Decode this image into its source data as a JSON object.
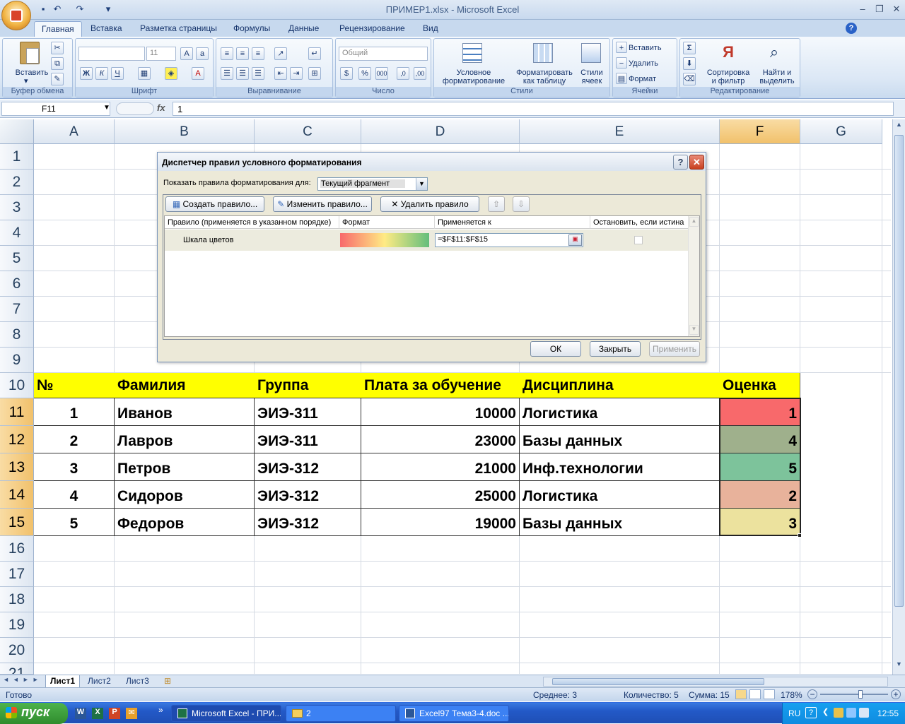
{
  "window": {
    "title": "ПРИМЕР1.xlsx - Microsoft Excel"
  },
  "ribbon": {
    "tabs": [
      "Главная",
      "Вставка",
      "Разметка страницы",
      "Формулы",
      "Данные",
      "Рецензирование",
      "Вид"
    ],
    "active_tab": "Главная",
    "groups": {
      "clipboard": {
        "label": "Буфер обмена",
        "paste": "Вставить"
      },
      "font": {
        "label": "Шрифт",
        "font_size": "11"
      },
      "alignment": {
        "label": "Выравнивание"
      },
      "number": {
        "label": "Число",
        "format": "Общий"
      },
      "styles": {
        "label": "Стили",
        "conditional": [
          "Условное",
          "форматирование"
        ],
        "table": [
          "Форматировать",
          "как таблицу"
        ],
        "cell_styles": [
          "Стили",
          "ячеек"
        ]
      },
      "cells": {
        "label": "Ячейки",
        "insert": "Вставить",
        "delete": "Удалить",
        "format": "Формат"
      },
      "editing": {
        "label": "Редактирование",
        "sort": [
          "Сортировка",
          "и фильтр"
        ],
        "find": [
          "Найти и",
          "выделить"
        ]
      }
    }
  },
  "formula_bar": {
    "name_box": "F11",
    "fx": "fx",
    "value": "1"
  },
  "grid": {
    "columns": [
      "A",
      "B",
      "C",
      "D",
      "E",
      "F",
      "G"
    ],
    "selected_column": "F",
    "rows": [
      "1",
      "2",
      "3",
      "4",
      "5",
      "6",
      "7",
      "8",
      "9",
      "10",
      "11",
      "12",
      "13",
      "14",
      "15",
      "16",
      "17",
      "18",
      "19",
      "20",
      "21"
    ],
    "selected_rows": [
      "11",
      "12",
      "13",
      "14",
      "15"
    ],
    "header_row": [
      "№",
      "Фамилия",
      "Группа",
      "Плата за обучение",
      "Дисциплина",
      "Оценка"
    ],
    "data_rows": [
      [
        "1",
        "Иванов",
        "ЭИЭ-311",
        "10000",
        "Логистика",
        "1"
      ],
      [
        "2",
        "Лавров",
        "ЭИЭ-311",
        "23000",
        "Базы данных",
        "4"
      ],
      [
        "3",
        "Петров",
        "ЭИЭ-312",
        "21000",
        "Инф.технологии",
        "5"
      ],
      [
        "4",
        "Сидоров",
        "ЭИЭ-312",
        "25000",
        "Логистика",
        "2"
      ],
      [
        "5",
        "Федоров",
        "ЭИЭ-312",
        "19000",
        "Базы данных",
        "3"
      ]
    ],
    "score_colors": [
      "#f8696b",
      "#9fb08c",
      "#7dc39b",
      "#e8b29b",
      "#ece29e"
    ],
    "header_fill": "#ffff00"
  },
  "dialog": {
    "title": "Диспетчер правил условного форматирования",
    "show_rules_label": "Показать правила форматирования для:",
    "show_rules_value": "Текущий фрагмент",
    "buttons": {
      "new_rule": "Создать правило...",
      "edit_rule": "Изменить правило...",
      "delete_rule": "Удалить правило",
      "ok": "ОК",
      "close": "Закрыть",
      "apply": "Применить"
    },
    "columns": [
      "Правило (применяется в указанном порядке)",
      "Формат",
      "Применяется к",
      "Остановить, если истина"
    ],
    "rule": {
      "name": "Шкала цветов",
      "applies_to": "=$F$11:$F$15",
      "stop_if_true": false
    }
  },
  "sheets": {
    "tabs": [
      "Лист1",
      "Лист2",
      "Лист3"
    ],
    "active": "Лист1"
  },
  "status": {
    "ready": "Готово",
    "average": "Среднее: 3",
    "count": "Количество: 5",
    "sum": "Сумма: 15",
    "zoom": "178%"
  },
  "taskbar": {
    "start": "пуск",
    "tasks": [
      "Microsoft Excel - ПРИ...",
      "2",
      "Excel97 Тема3-4.doc ..."
    ],
    "lang": "RU",
    "clock": "12:55"
  }
}
